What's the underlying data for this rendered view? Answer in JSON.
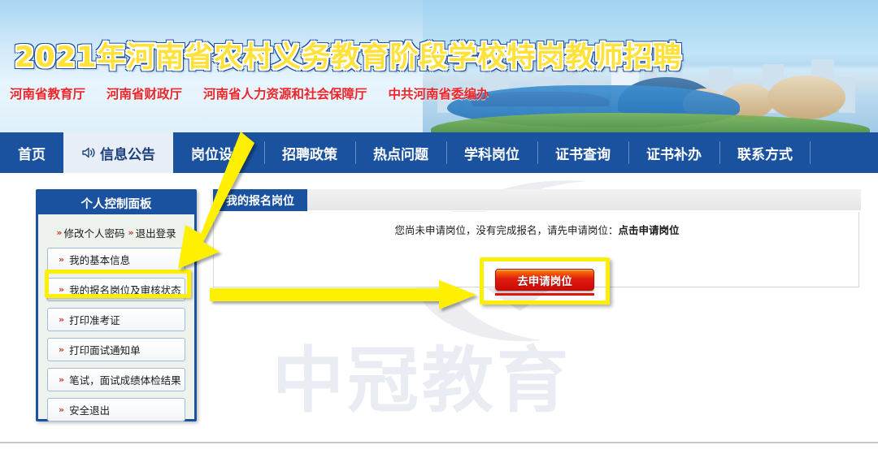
{
  "banner": {
    "title": "2021年河南省农村义务教育阶段学校特岗教师招聘",
    "dept_links": [
      "河南省教育厅",
      "河南省财政厅",
      "河南省人力资源和社会保障厅",
      "中共河南省委编办"
    ]
  },
  "nav": {
    "items": [
      {
        "label": "首页",
        "icon": "",
        "active": false
      },
      {
        "label": "信息公告",
        "icon": "speaker-icon",
        "active": true
      },
      {
        "label": "岗位设置",
        "icon": "",
        "active": false
      },
      {
        "label": "招聘政策",
        "icon": "",
        "active": false
      },
      {
        "label": "热点问题",
        "icon": "",
        "active": false
      },
      {
        "label": "学科岗位",
        "icon": "",
        "active": false
      },
      {
        "label": "证书查询",
        "icon": "",
        "active": false
      },
      {
        "label": "证书补办",
        "icon": "",
        "active": false
      },
      {
        "label": "联系方式",
        "icon": "",
        "active": false
      }
    ]
  },
  "sidebar": {
    "header": "个人控制面板",
    "top_links": [
      "修改个人密码",
      "退出登录"
    ],
    "items": [
      "我的基本信息",
      "我的报名岗位及审核状态",
      "打印准考证",
      "打印面试通知单",
      "笔试，面试成绩体检结果",
      "安全退出"
    ]
  },
  "main": {
    "tab_label": "我的报名岗位",
    "message_plain": "您尚未申请岗位，没有完成报名，请先申请岗位：",
    "message_bold": "点击申请岗位",
    "apply_button_label": "去申请岗位"
  },
  "watermark": {
    "text": "中冠教育"
  },
  "annotations": {
    "highlight_color": "#ffef00",
    "arrow_color": "#ffef00",
    "sidebar_highlight_target": "我的报名岗位及审核状态",
    "button_highlight_target": "去申请岗位"
  },
  "colors": {
    "nav_blue": "#1a52a0",
    "header_red": "#e8262c",
    "title_yellow": "#ffe13a",
    "button_red": "#e01c10",
    "highlight_yellow": "#ffef00"
  }
}
